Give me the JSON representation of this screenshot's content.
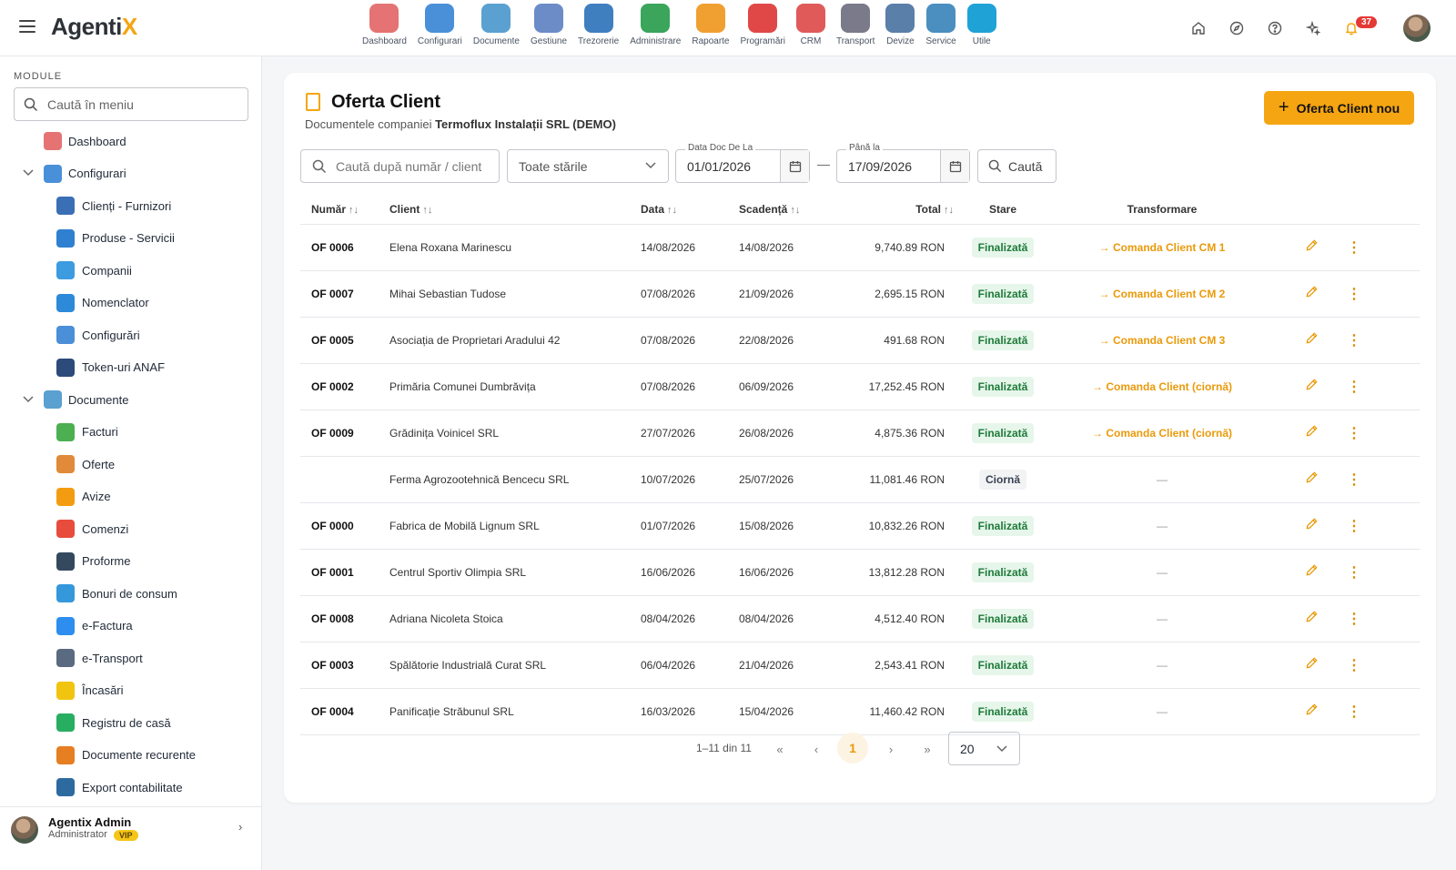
{
  "app": {
    "logo_main": "Agenti",
    "logo_accent": "X"
  },
  "topnav": [
    {
      "label": "Dashboard",
      "icon": "dashboard-icon",
      "color": "#e57373"
    },
    {
      "label": "Configurari",
      "icon": "wrench-icon",
      "color": "#4a90d9"
    },
    {
      "label": "Documente",
      "icon": "documents-icon",
      "color": "#5aa0d0"
    },
    {
      "label": "Gestiune",
      "icon": "warehouse-icon",
      "color": "#6b8cc7"
    },
    {
      "label": "Trezorerie",
      "icon": "bank-icon",
      "color": "#3f7fbf"
    },
    {
      "label": "Administrare",
      "icon": "shield-icon",
      "color": "#3aa55b"
    },
    {
      "label": "Rapoarte",
      "icon": "reports-icon",
      "color": "#f0a030"
    },
    {
      "label": "Programări",
      "icon": "clock-icon",
      "color": "#e04848"
    },
    {
      "label": "CRM",
      "icon": "crm-icon",
      "color": "#e05a5a"
    },
    {
      "label": "Transport",
      "icon": "truck-icon",
      "color": "#7a7a8a"
    },
    {
      "label": "Devize",
      "icon": "estimate-icon",
      "color": "#5a7fa8"
    },
    {
      "label": "Service",
      "icon": "car-icon",
      "color": "#4a8fc0"
    },
    {
      "label": "Utile",
      "icon": "help-icon",
      "color": "#1fa3d6"
    }
  ],
  "topbar": {
    "notifications_count": "37"
  },
  "sidebar": {
    "title": "MODULE",
    "search_placeholder": "Caută în meniu",
    "items": [
      {
        "label": "Dashboard",
        "level": 0,
        "icon": "dashboard-icon",
        "color": "#e57373"
      },
      {
        "label": "Configurari",
        "level": 0,
        "icon": "wrench-icon",
        "color": "#4a90d9",
        "expanded": true
      },
      {
        "label": "Clienți - Furnizori",
        "level": 1,
        "icon": "people-icon",
        "color": "#3a6fb5"
      },
      {
        "label": "Produse - Servicii",
        "level": 1,
        "icon": "product-icon",
        "color": "#2f80d1"
      },
      {
        "label": "Companii",
        "level": 1,
        "icon": "company-icon",
        "color": "#3d9be0"
      },
      {
        "label": "Nomenclator",
        "level": 1,
        "icon": "list-icon",
        "color": "#2d8ad8"
      },
      {
        "label": "Configurări",
        "level": 1,
        "icon": "settings-list-icon",
        "color": "#4a8fd8"
      },
      {
        "label": "Token-uri ANAF",
        "level": 1,
        "icon": "shield-key-icon",
        "color": "#2c4a7a"
      },
      {
        "label": "Documente",
        "level": 0,
        "icon": "documents-icon",
        "color": "#5aa0d0",
        "expanded": true
      },
      {
        "label": "Facturi",
        "level": 1,
        "icon": "invoice-icon",
        "color": "#4caf50"
      },
      {
        "label": "Oferte",
        "level": 1,
        "icon": "offer-icon",
        "color": "#e08a3a"
      },
      {
        "label": "Avize",
        "level": 1,
        "icon": "delivery-icon",
        "color": "#f39c12"
      },
      {
        "label": "Comenzi",
        "level": 1,
        "icon": "cart-icon",
        "color": "#e74c3c"
      },
      {
        "label": "Proforme",
        "level": 1,
        "icon": "calculator-icon",
        "color": "#34495e"
      },
      {
        "label": "Bonuri de consum",
        "level": 1,
        "icon": "receipt-icon",
        "color": "#3498db"
      },
      {
        "label": "e-Factura",
        "level": 1,
        "icon": "cloud-icon",
        "color": "#2d8ef0"
      },
      {
        "label": "e-Transport",
        "level": 1,
        "icon": "truck-icon",
        "color": "#5a6a80"
      },
      {
        "label": "Încasări",
        "level": 1,
        "icon": "chart-icon",
        "color": "#f1c40f"
      },
      {
        "label": "Registru de casă",
        "level": 1,
        "icon": "cash-icon",
        "color": "#27ae60"
      },
      {
        "label": "Documente recurente",
        "level": 1,
        "icon": "recurring-icon",
        "color": "#e67e22"
      },
      {
        "label": "Export contabilitate",
        "level": 1,
        "icon": "export-icon",
        "color": "#2c6aa0"
      }
    ],
    "user": {
      "name": "Agentix Admin",
      "role": "Administrator",
      "badge": "VIP"
    }
  },
  "page": {
    "title": "Oferta Client",
    "subtitle_prefix": "Documentele companiei ",
    "company": "Termoflux Instalații SRL (DEMO)",
    "new_button": "Oferta Client nou"
  },
  "filters": {
    "search_placeholder": "Caută după număr / client",
    "status_value": "Toate stările",
    "date_from_label": "Data Doc De La",
    "date_from": "01/01/2026",
    "date_to_label": "Până la",
    "date_to": "17/09/2026",
    "search_button": "Caută"
  },
  "table": {
    "headers": [
      "Număr",
      "Client",
      "Data",
      "Scadență",
      "Total",
      "Stare",
      "Transformare"
    ],
    "rows": [
      {
        "num": "OF 0006",
        "client": "Elena Roxana Marinescu",
        "data": "14/08/2026",
        "scad": "14/08/2026",
        "total": "9,740.89 RON",
        "stare": "Finalizată",
        "trans": "Comanda Client CM 1"
      },
      {
        "num": "OF 0007",
        "client": "Mihai Sebastian Tudose",
        "data": "07/08/2026",
        "scad": "21/09/2026",
        "total": "2,695.15 RON",
        "stare": "Finalizată",
        "trans": "Comanda Client CM 2"
      },
      {
        "num": "OF 0005",
        "client": "Asociația de Proprietari Aradului 42",
        "data": "07/08/2026",
        "scad": "22/08/2026",
        "total": "491.68 RON",
        "stare": "Finalizată",
        "trans": "Comanda Client CM 3"
      },
      {
        "num": "OF 0002",
        "client": "Primăria Comunei Dumbrăvița",
        "data": "07/08/2026",
        "scad": "06/09/2026",
        "total": "17,252.45 RON",
        "stare": "Finalizată",
        "trans": "Comanda Client (ciornă)"
      },
      {
        "num": "OF 0009",
        "client": "Grădinița Voinicel SRL",
        "data": "27/07/2026",
        "scad": "26/08/2026",
        "total": "4,875.36 RON",
        "stare": "Finalizată",
        "trans": "Comanda Client (ciornă)"
      },
      {
        "num": "",
        "client": "Ferma Agrozootehnică Bencecu SRL",
        "data": "10/07/2026",
        "scad": "25/07/2026",
        "total": "11,081.46 RON",
        "stare": "Ciornă",
        "trans": ""
      },
      {
        "num": "OF 0000",
        "client": "Fabrica de Mobilă Lignum SRL",
        "data": "01/07/2026",
        "scad": "15/08/2026",
        "total": "10,832.26 RON",
        "stare": "Finalizată",
        "trans": ""
      },
      {
        "num": "OF 0001",
        "client": "Centrul Sportiv Olimpia SRL",
        "data": "16/06/2026",
        "scad": "16/06/2026",
        "total": "13,812.28 RON",
        "stare": "Finalizată",
        "trans": ""
      },
      {
        "num": "OF 0008",
        "client": "Adriana Nicoleta Stoica",
        "data": "08/04/2026",
        "scad": "08/04/2026",
        "total": "4,512.40 RON",
        "stare": "Finalizată",
        "trans": ""
      },
      {
        "num": "OF 0003",
        "client": "Spălătorie Industrială Curat SRL",
        "data": "06/04/2026",
        "scad": "21/04/2026",
        "total": "2,543.41 RON",
        "stare": "Finalizată",
        "trans": ""
      },
      {
        "num": "OF 0004",
        "client": "Panificație Străbunul SRL",
        "data": "16/03/2026",
        "scad": "15/04/2026",
        "total": "11,460.42 RON",
        "stare": "Finalizată",
        "trans": ""
      }
    ]
  },
  "pagination": {
    "info": "1–11 din 11",
    "current_page": "1",
    "page_size": "20"
  },
  "colors": {
    "accent": "#f5a511",
    "status_final": "#1e7a3a",
    "status_final_bg": "#e6f6ea"
  }
}
